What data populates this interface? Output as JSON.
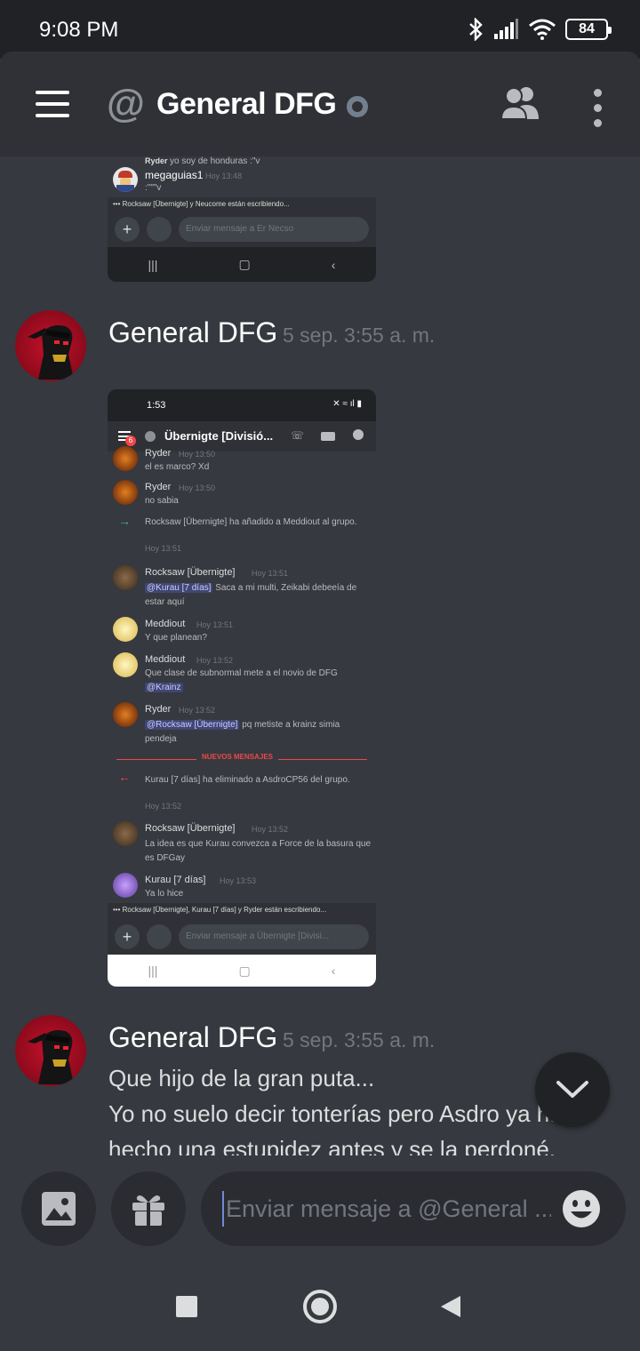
{
  "status_bar": {
    "time": "9:08 PM",
    "battery": "84",
    "icons": [
      "bluetooth-icon",
      "signal-icon",
      "wifi-icon",
      "battery-icon"
    ]
  },
  "header": {
    "channel_name": "General DFG",
    "icons": [
      "menu-icon",
      "at-icon",
      "status-dot-icon",
      "members-icon",
      "more-options-icon"
    ]
  },
  "embed_top": {
    "line1_author": "Ryder",
    "line1_text": "yo soy de honduras :\"v",
    "author": "megaguias1",
    "time": "Hoy 13:48",
    "text": ":\"\"\"v",
    "typing": "Rocksaw [Übernigte] y Neucome están escribiendo...",
    "placeholder": "Enviar mensaje a Er Necso"
  },
  "messages": [
    {
      "author": "General DFG",
      "timestamp": "5 sep. 3:55 a. m."
    },
    {
      "author": "General DFG",
      "timestamp": "5 sep. 3:55 a. m.",
      "lines": [
        "Que hijo de la gran puta...",
        "Yo no suelo decir tonterías pero Asdro ya ha",
        "hecho una estupidez antes y se la perdoné."
      ]
    }
  ],
  "embed_main": {
    "status_time": "1:53",
    "channel": "Übernigte [Divisió...",
    "badge": "6",
    "items": [
      {
        "author": "Ryder",
        "time": "Hoy 13:50",
        "text": "el es marco? Xd"
      },
      {
        "author": "Ryder",
        "time": "Hoy 13:50",
        "text": "no sabia"
      },
      {
        "system": "Rocksaw [Übernigte] ha añadido a Meddiout al grupo.",
        "time": "Hoy 13:51"
      },
      {
        "author": "Rocksaw [Übernigte]",
        "time": "Hoy 13:51",
        "mention": "@Kurau [7 días]",
        "text": "Saca a mi multi, Zeikabi debeeía de estar aquí"
      },
      {
        "author": "Meddiout",
        "time": "Hoy 13:51",
        "text": "Y que planean?"
      },
      {
        "author": "Meddiout",
        "time": "Hoy 13:52",
        "text": "Que clase de subnormal mete a el novio de DFG",
        "mention": "@Krainz"
      },
      {
        "author": "Ryder",
        "time": "Hoy 13:52",
        "mention": "@Rocksaw [Übernigte]",
        "text": "pq metiste a krainz simia pendeja"
      },
      {
        "divider": "NUEVOS MENSAJES"
      },
      {
        "system": "Kurau [7 días] ha eliminado a AsdroCP56 del grupo.",
        "time": "Hoy 13:52"
      },
      {
        "author": "Rocksaw [Übernigte]",
        "time": "Hoy 13:52",
        "text": "La idea es que Kurau convezca a Force de la basura que es DFGay"
      },
      {
        "author": "Kurau [7 días]",
        "time": "Hoy 13:53",
        "text": "Ya lo hice"
      }
    ],
    "typing": "Rocksaw [Übernigte], Kurau [7 días] y Ryder están escribiendo...",
    "placeholder": "Enviar mensaje a Übernigte [Divisi..."
  },
  "composer": {
    "placeholder": "Enviar mensaje a @General ...",
    "icons": [
      "image-icon",
      "gift-icon",
      "emoji-icon"
    ]
  },
  "nav": {
    "icons": [
      "recents-icon",
      "home-icon",
      "back-icon"
    ]
  },
  "colors": {
    "background": "#36393f",
    "header": "#2f3136",
    "accent": "#7289da",
    "avatar_red": "#c5122b",
    "new_messages": "#f04747"
  }
}
